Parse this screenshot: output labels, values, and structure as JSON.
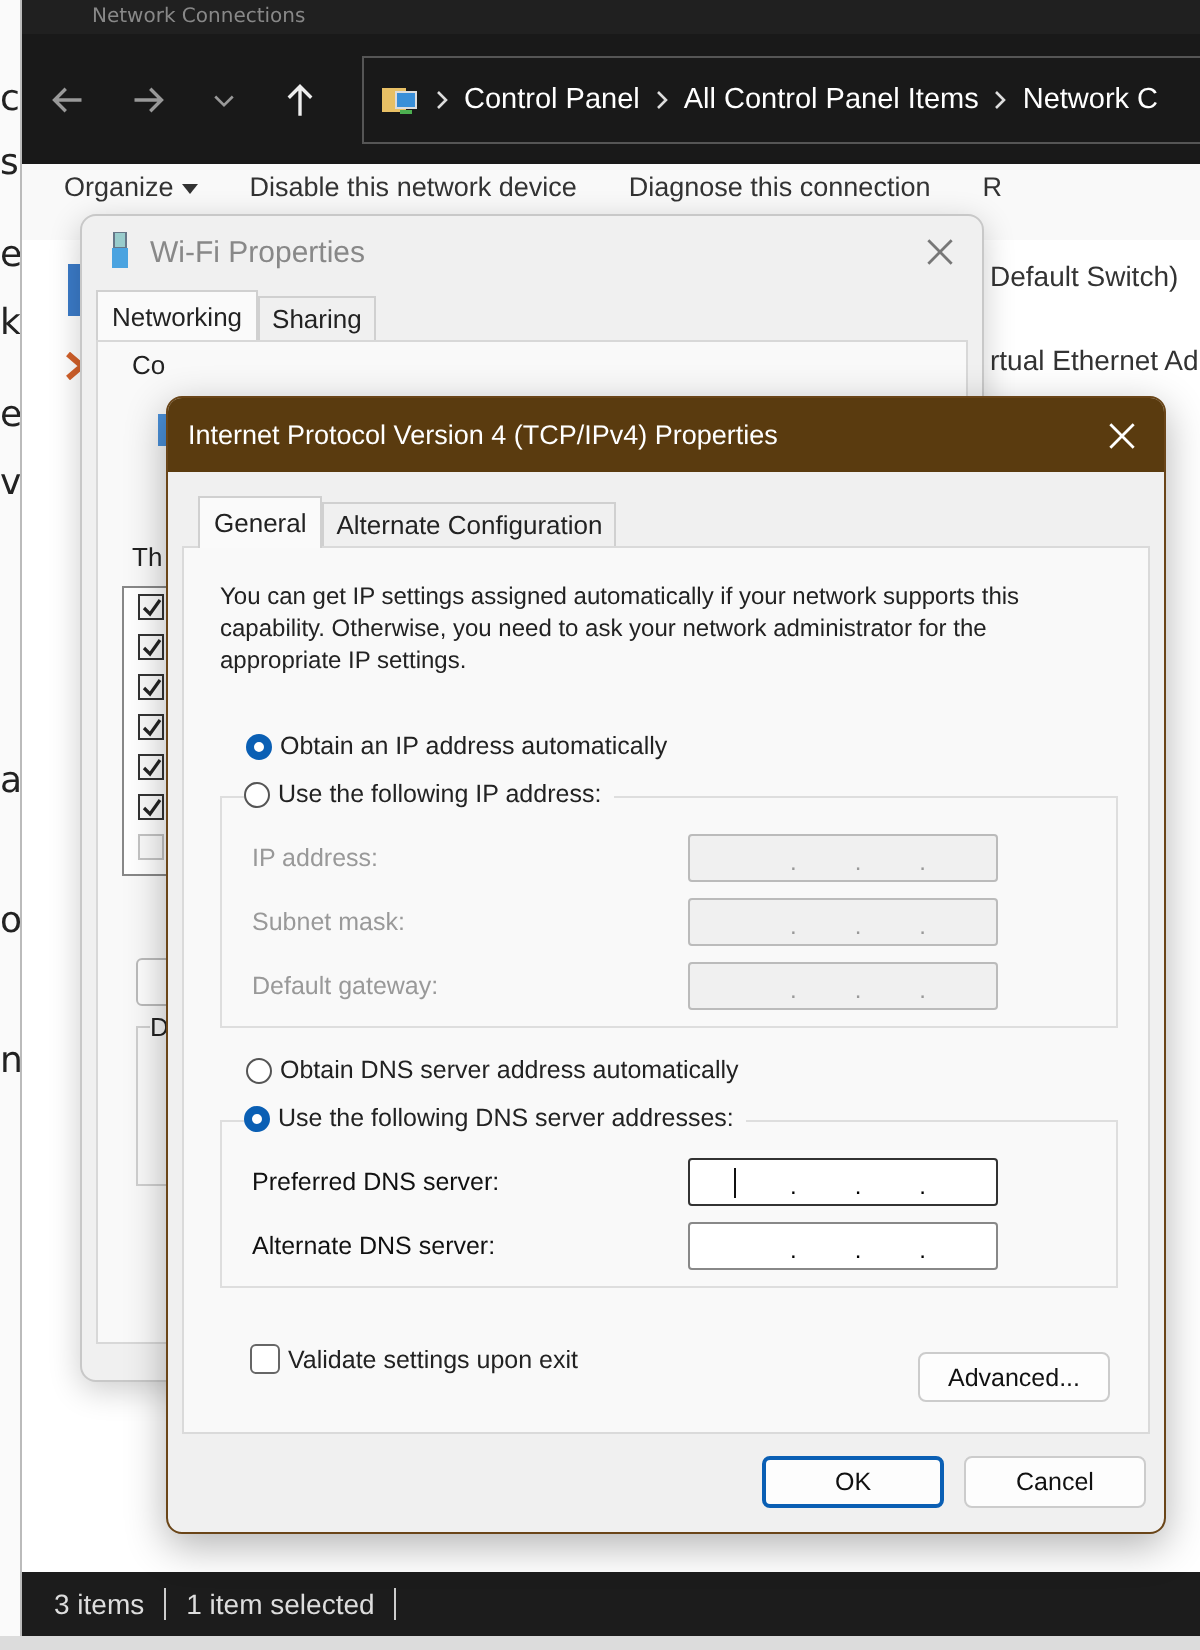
{
  "left_fragments": [
    "c",
    "s",
    "e",
    "k",
    "e",
    "v",
    "a",
    "o",
    "n"
  ],
  "explorer": {
    "title": "Network Connections",
    "breadcrumb": [
      "Control Panel",
      "All Control Panel Items",
      "Network C"
    ],
    "commands": [
      {
        "label": "Organize",
        "dropdown": true
      },
      {
        "label": "Disable this network device",
        "dropdown": false
      },
      {
        "label": "Diagnose this connection",
        "dropdown": false
      },
      {
        "label": "R",
        "dropdown": false
      }
    ],
    "items": [
      "Default Switch)",
      "rtual Ethernet Ad"
    ],
    "status": [
      "3 items",
      "1 item selected"
    ]
  },
  "wifi_dialog": {
    "title": "Wi-Fi Properties",
    "tabs": [
      {
        "label": "Networking",
        "selected": true
      },
      {
        "label": "Sharing",
        "selected": false
      }
    ],
    "connect_label": "Co",
    "list_label": "Th",
    "components": [
      {
        "checked": true
      },
      {
        "checked": true
      },
      {
        "checked": true
      },
      {
        "checked": true
      },
      {
        "checked": true
      },
      {
        "checked": true
      },
      {
        "checked": false
      }
    ],
    "group_label": "D"
  },
  "ipv4_dialog": {
    "title": "Internet Protocol Version 4 (TCP/IPv4) Properties",
    "tabs": [
      {
        "label": "General",
        "selected": true
      },
      {
        "label": "Alternate Configuration",
        "selected": false
      }
    ],
    "description": "You can get IP settings assigned automatically if your network supports this capability. Otherwise, you need to ask your network administrator for the appropriate IP settings.",
    "ip_auto": {
      "label": "Obtain an IP address automatically",
      "selected": true
    },
    "ip_manual": {
      "label": "Use the following IP address:",
      "selected": false
    },
    "ip_fields": [
      {
        "label": "IP address:",
        "disabled": true,
        "focused": false
      },
      {
        "label": "Subnet mask:",
        "disabled": true,
        "focused": false
      },
      {
        "label": "Default gateway:",
        "disabled": true,
        "focused": false
      }
    ],
    "dns_auto": {
      "label": "Obtain DNS server address automatically",
      "selected": false
    },
    "dns_manual": {
      "label": "Use the following DNS server addresses:",
      "selected": true
    },
    "dns_fields": [
      {
        "label": "Preferred DNS server:",
        "disabled": false,
        "focused": true
      },
      {
        "label": "Alternate DNS server:",
        "disabled": false,
        "focused": false
      }
    ],
    "separator": ".",
    "validate": {
      "label": "Validate settings upon exit",
      "checked": false
    },
    "advanced": "Advanced...",
    "ok": "OK",
    "cancel": "Cancel"
  }
}
